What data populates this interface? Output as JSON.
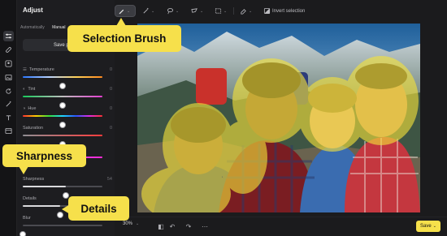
{
  "panel": {
    "title": "Adjust",
    "tabs": [
      "Automatically",
      "Manual"
    ],
    "save_preset": "Save preset",
    "sliders": [
      {
        "label": "Temperature",
        "value": "0",
        "level": 0.5
      },
      {
        "label": "Tint",
        "value": "0",
        "level": 0.5
      },
      {
        "label": "Hue",
        "value": "0",
        "level": 0.5
      },
      {
        "label": "Saturation",
        "value": "0",
        "level": 0.5
      },
      {
        "label": "Sharpness",
        "value": "54",
        "level": 0.54
      },
      {
        "label": "Details",
        "value": "",
        "level": 0.47
      },
      {
        "label": "Blur",
        "value": "0",
        "level": 0.0
      }
    ]
  },
  "callouts": {
    "selection_brush": "Selection Brush",
    "sharpness": "Sharpness",
    "details": "Details"
  },
  "toolbar": {
    "invert_selection": "Invert selection",
    "tools": [
      "brush-icon",
      "magic-wand-icon",
      "lasso-icon",
      "polygon-lasso-icon",
      "rect-select-icon",
      "eraser-icon"
    ]
  },
  "bottom": {
    "zoom": "30%",
    "save": "Save"
  },
  "colors": {
    "accent": "#f6e04b",
    "panel_bg": "#1d1d20",
    "app_bg": "#1b1b1d"
  }
}
